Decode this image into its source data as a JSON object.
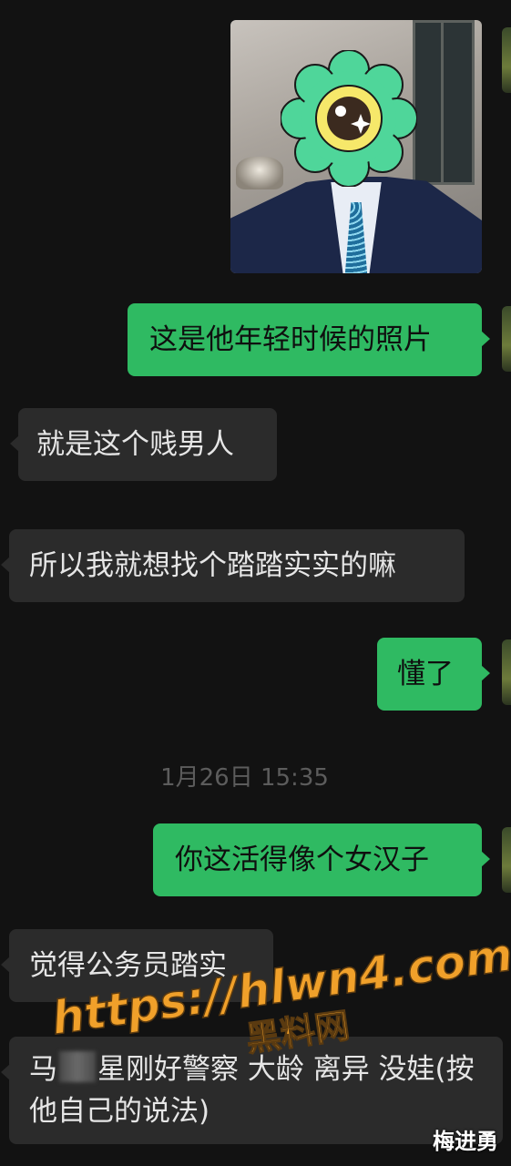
{
  "chat": {
    "messages": [
      {
        "type": "image",
        "side": "out",
        "description_icon": "flower-sticker-icon"
      },
      {
        "type": "text",
        "side": "out",
        "text": "这是他年轻时候的照片"
      },
      {
        "type": "text",
        "side": "in",
        "text": "就是这个贱男人"
      },
      {
        "type": "text",
        "side": "in",
        "text": "所以我就想找个踏踏实实的嘛"
      },
      {
        "type": "text",
        "side": "out",
        "text": "懂了"
      },
      {
        "type": "text",
        "side": "out",
        "text": "你这活得像个女汉子"
      },
      {
        "type": "text",
        "side": "in",
        "text": "觉得公务员踏实"
      },
      {
        "type": "text",
        "side": "in",
        "text_before": "马",
        "text_after": "星刚好警察 大龄 离异 没娃(按他自己的说法)"
      }
    ],
    "timestamp": "1月26日 15:35"
  },
  "watermark": {
    "url": "https://hlwn4.com",
    "site": "黑料网",
    "color": "#f0a02a"
  },
  "signature": "梅进勇",
  "colors": {
    "outgoing_bubble": "#2fba62",
    "incoming_bubble": "#2b2b2b",
    "background": "#121212"
  }
}
